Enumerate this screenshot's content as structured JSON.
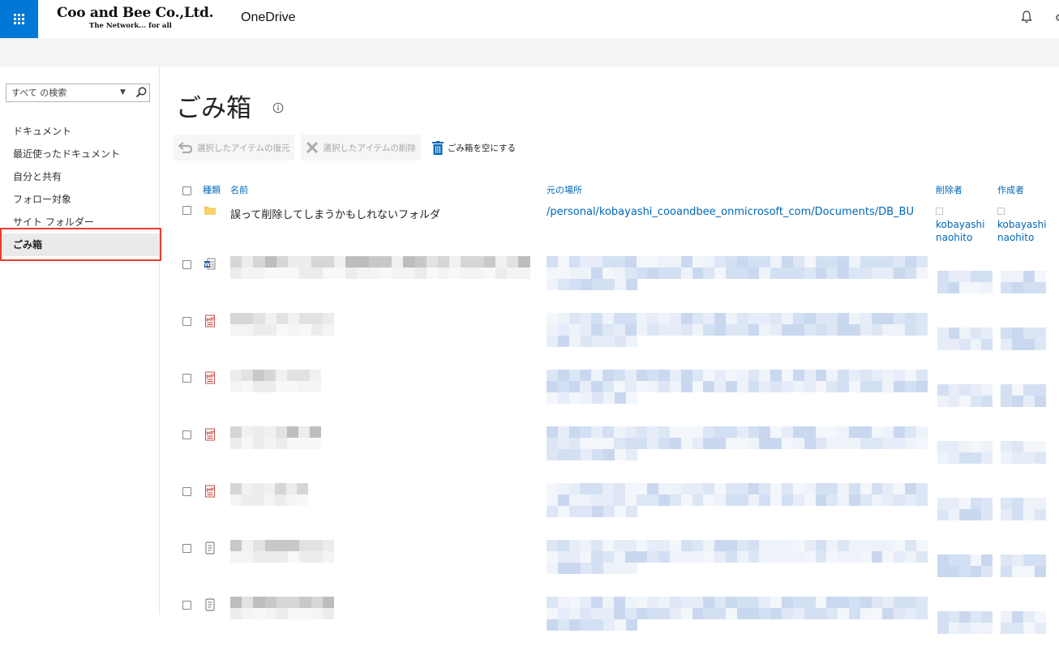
{
  "topbar": {
    "brand_name": "Coo and Bee Co.,Ltd.",
    "brand_sub": "The Network... for all",
    "app_title": "OneDrive"
  },
  "search": {
    "placeholder": "すべて の検索"
  },
  "nav": {
    "items": [
      {
        "label": "ドキュメント",
        "selected": false
      },
      {
        "label": "最近使ったドキュメント",
        "selected": false
      },
      {
        "label": "自分と共有",
        "selected": false
      },
      {
        "label": "フォロー対象",
        "selected": false
      },
      {
        "label": "サイト フォルダー",
        "selected": false
      },
      {
        "label": "ごみ箱",
        "selected": true
      }
    ]
  },
  "page": {
    "title": "ごみ箱"
  },
  "commands": {
    "restore": "選択したアイテムの復元",
    "delete": "選択したアイテムの削除",
    "empty": "ごみ箱を空にする"
  },
  "table": {
    "headers": {
      "type": "種類",
      "name": "名前",
      "location": "元の場所",
      "deleted_by": "削除者",
      "created_by": "作成者"
    },
    "rows": [
      {
        "icon": "folder-icon",
        "name": "誤って削除してしまうかもしれないフォルダ",
        "location": "/personal/kobayashi_cooandbee_onmicrosoft_com/Documents/DB_BU",
        "deleted_by_line1": "kobayashi",
        "deleted_by_line2": "naohito",
        "created_by_line1": "kobayashi",
        "created_by_line2": "naohito"
      },
      {
        "icon": "word-doc-icon"
      },
      {
        "icon": "pdf-icon"
      },
      {
        "icon": "pdf-icon"
      },
      {
        "icon": "pdf-icon"
      },
      {
        "icon": "pdf-icon"
      },
      {
        "icon": "text-doc-icon"
      },
      {
        "icon": "text-doc-icon"
      }
    ]
  },
  "colors": {
    "accent": "#0078d7",
    "link": "#0067b8",
    "highlight": "#ea3b2d",
    "blur_blue": "#dce6f5",
    "blur_gray": "#e4e4e4"
  }
}
